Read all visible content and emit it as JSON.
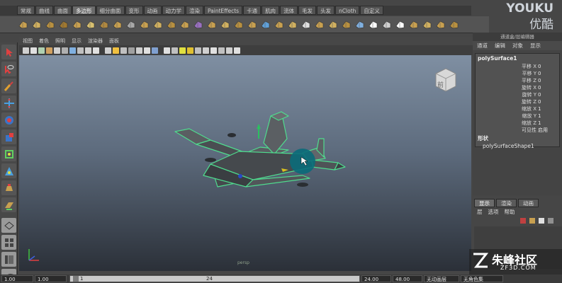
{
  "shelf": {
    "tabs": [
      "常规",
      "曲线",
      "曲面",
      "多边形",
      "细分曲面",
      "变形",
      "动画",
      "动力学",
      "渲染",
      "PaintEffects",
      "卡通",
      "肌肉",
      "流体",
      "毛发",
      "头发",
      "nCloth",
      "自定义"
    ],
    "active_tab_index": 3
  },
  "logo": {
    "brand_en": "YOUKU",
    "brand_cn": "优酷"
  },
  "viewport": {
    "menus": [
      "视图",
      "着色",
      "照明",
      "显示",
      "渲染器",
      "面板"
    ],
    "viewcube_label": "前",
    "caption": "persp"
  },
  "channel_box": {
    "title": "通道盒/层编辑器",
    "menus": [
      "通道",
      "编辑",
      "对象",
      "显示"
    ],
    "object_name": "polySurface1",
    "attributes": [
      {
        "name": "平移 X",
        "value": "0"
      },
      {
        "name": "平移 Y",
        "value": "0"
      },
      {
        "name": "平移 Z",
        "value": "0"
      },
      {
        "name": "旋转 X",
        "value": "0"
      },
      {
        "name": "旋转 Y",
        "value": "0"
      },
      {
        "name": "旋转 Z",
        "value": "0"
      },
      {
        "name": "缩放 X",
        "value": "1"
      },
      {
        "name": "缩放 Y",
        "value": "1"
      },
      {
        "name": "缩放 Z",
        "value": "1"
      },
      {
        "name": "可见性",
        "value": "启用"
      }
    ],
    "shapes_header": "形状",
    "shape_name": "polySurfaceShape1"
  },
  "layer_editor": {
    "tabs": [
      "显示",
      "渲染",
      "动画"
    ],
    "active_tab_index": 0,
    "menus": [
      "层",
      "选项",
      "帮助"
    ]
  },
  "range": {
    "start_min": "1.00",
    "start": "1.00",
    "slider_start": "1",
    "slider_end": "24",
    "end": "24.00",
    "end_max": "48.00",
    "anim_layer": "无动画层",
    "char_set": "无角色集"
  },
  "watermark": {
    "text_cn": "朱峰社区",
    "text_en": "ZF3D.COM"
  },
  "colors": {
    "shelf_active": "#6b6b6b",
    "wireframe": "#4fdc8e",
    "viewport_top": "#7f8fa2",
    "viewport_bottom": "#2b3038",
    "cursor_highlight": "#0a6b7a"
  }
}
